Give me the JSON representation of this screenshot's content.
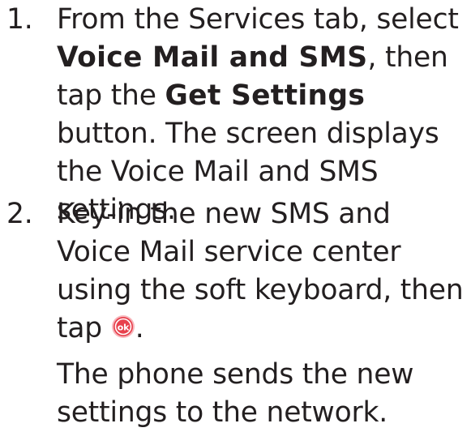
{
  "steps": [
    {
      "number": "1.",
      "text_before": "From the Services tab, select ",
      "bold_1": "Voice Mail and SMS",
      "text_middle": ", then tap the ",
      "bold_2": "Get Settings",
      "text_after": " button. The screen displays the Voice Mail and SMS settings."
    },
    {
      "number": "2.",
      "text_before_icon": "Key-in the new SMS and Voice Mail service center using the soft keyboard, then tap ",
      "icon": "ok-button-icon",
      "text_after_icon": ".",
      "note": "The phone sends the new settings to the network."
    }
  ],
  "colors": {
    "text": "#231f20",
    "ok_icon_fill": "#e8414d",
    "ok_icon_ring": "#f7b7bd"
  }
}
